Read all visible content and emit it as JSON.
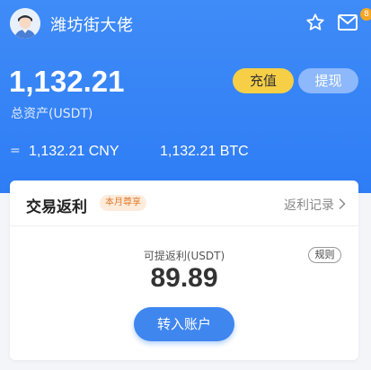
{
  "header": {
    "username": "潍坊街大佬",
    "mail_badge_count": "8",
    "icons": [
      "avatar",
      "star-icon",
      "mail-icon"
    ]
  },
  "assets": {
    "total_amount": "1,132.21",
    "total_label": "总资产(USDT)",
    "recharge_label": "充值",
    "withdraw_label": "提现",
    "equals_sign": "=",
    "cny_value": "1,132.21 CNY",
    "btc_value": "1,132.21 BTC"
  },
  "rebate_card": {
    "title": "交易返利",
    "tag": "本月尊享",
    "records_link": "返利记录",
    "withdrawable_label": "可提返利(USDT)",
    "rules_label": "规则",
    "amount": "89.89",
    "transfer_button": "转入账户"
  },
  "colors": {
    "header_blue": "#2f7df5",
    "recharge_yellow": "#f6cf47",
    "withdraw_blue": "#8db8fb",
    "badge_orange": "#f5a623"
  }
}
